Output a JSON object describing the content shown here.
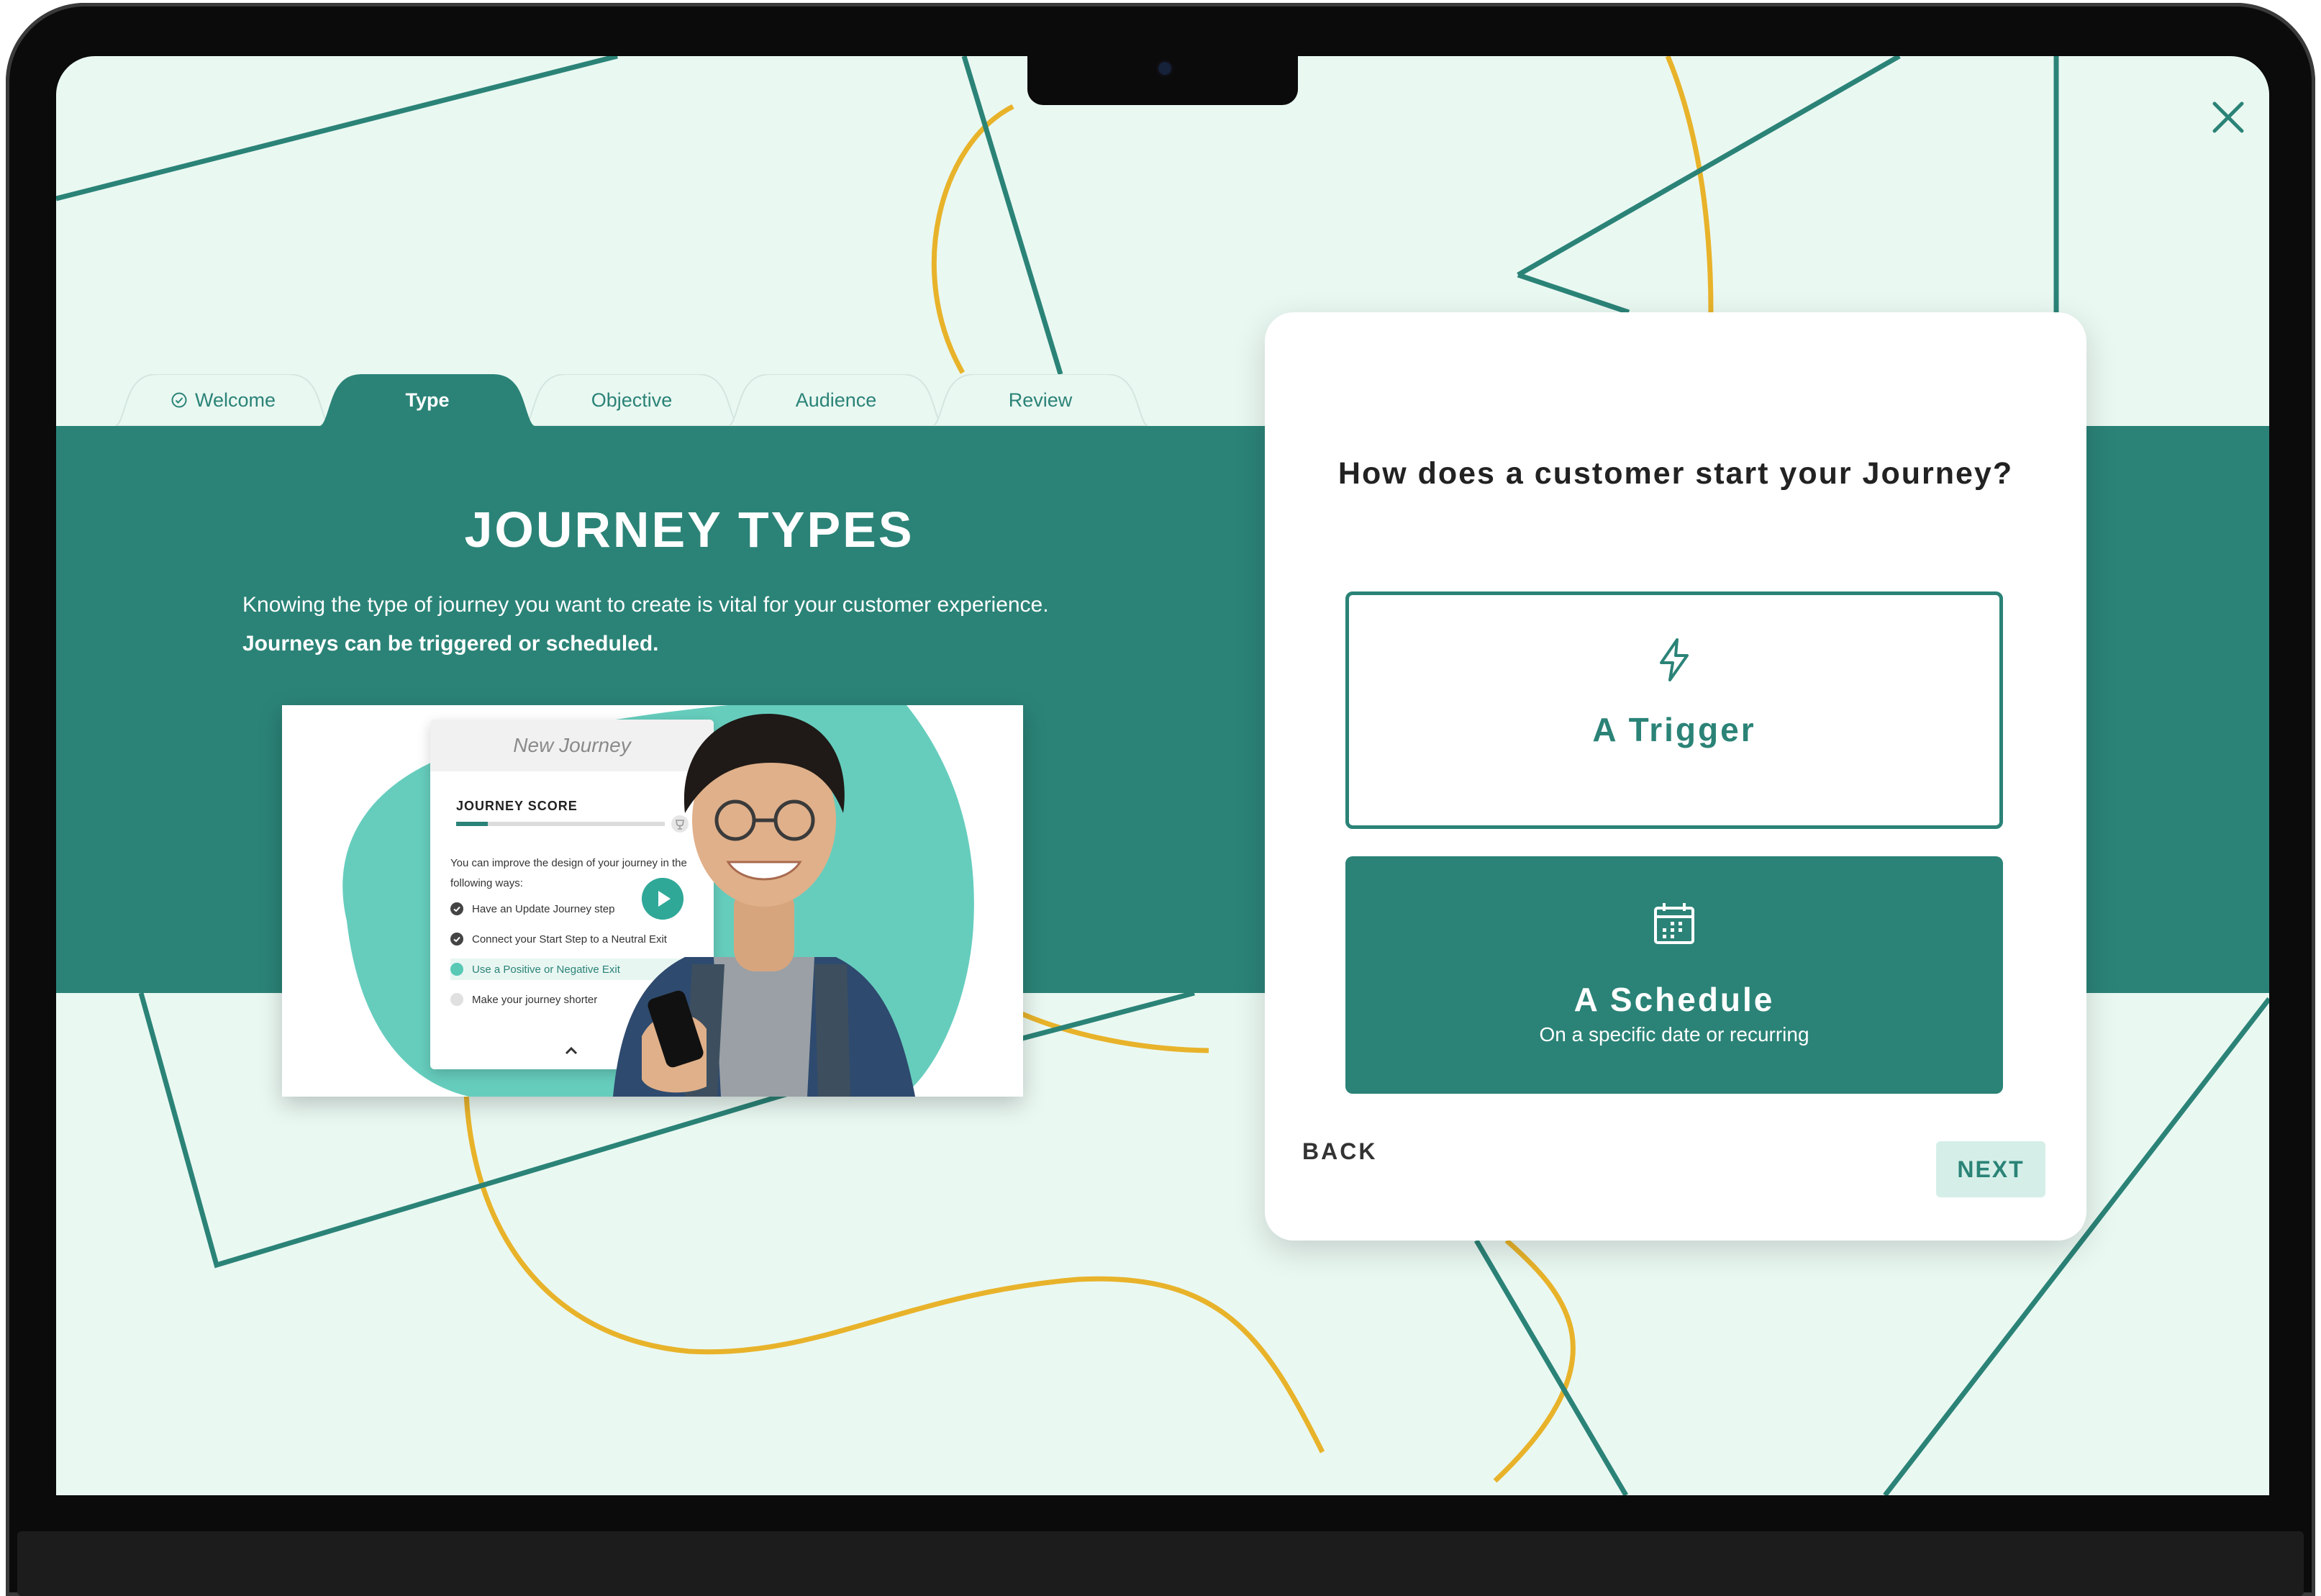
{
  "tabs": [
    {
      "label": "Welcome",
      "state": "completed"
    },
    {
      "label": "Type",
      "state": "active"
    },
    {
      "label": "Objective",
      "state": "upcoming"
    },
    {
      "label": "Audience",
      "state": "upcoming"
    },
    {
      "label": "Review",
      "state": "upcoming"
    }
  ],
  "hero": {
    "title": "JOURNEY TYPES",
    "description": "Knowing the type of journey you want to create is vital for your customer experience.",
    "description_bold": "Journeys can be triggered or scheduled."
  },
  "preview": {
    "card_title": "New Journey",
    "score_label": "JOURNEY SCORE",
    "score_progress": 0.15,
    "improve_text": "You can improve the design of your journey in the following ways:",
    "tips": [
      {
        "label": "Have an Update Journey step",
        "state": "done"
      },
      {
        "label": "Connect your Start Step to a Neutral Exit",
        "state": "done"
      },
      {
        "label": "Use a Positive or Negative Exit",
        "state": "highlighted"
      },
      {
        "label": "Make your journey shorter",
        "state": "todo"
      }
    ]
  },
  "card": {
    "question": "How does a customer start your Journey?",
    "options": [
      {
        "title": "A Trigger",
        "subtitle": "",
        "icon": "lightning-icon",
        "selected": false
      },
      {
        "title": "A Schedule",
        "subtitle": "On a specific date or recurring",
        "icon": "calendar-icon",
        "selected": true
      }
    ],
    "back_label": "BACK",
    "next_label": "NEXT"
  },
  "colors": {
    "primary": "#2b8377",
    "background": "#eaf8f2",
    "accent_yellow": "#e8b32a",
    "next_button_bg": "#d5efe8",
    "blob": "#66cdbd"
  },
  "icons": [
    "close-icon",
    "check-circle-icon",
    "lightning-icon",
    "calendar-icon",
    "play-icon",
    "trophy-icon",
    "chevron-up-icon"
  ]
}
